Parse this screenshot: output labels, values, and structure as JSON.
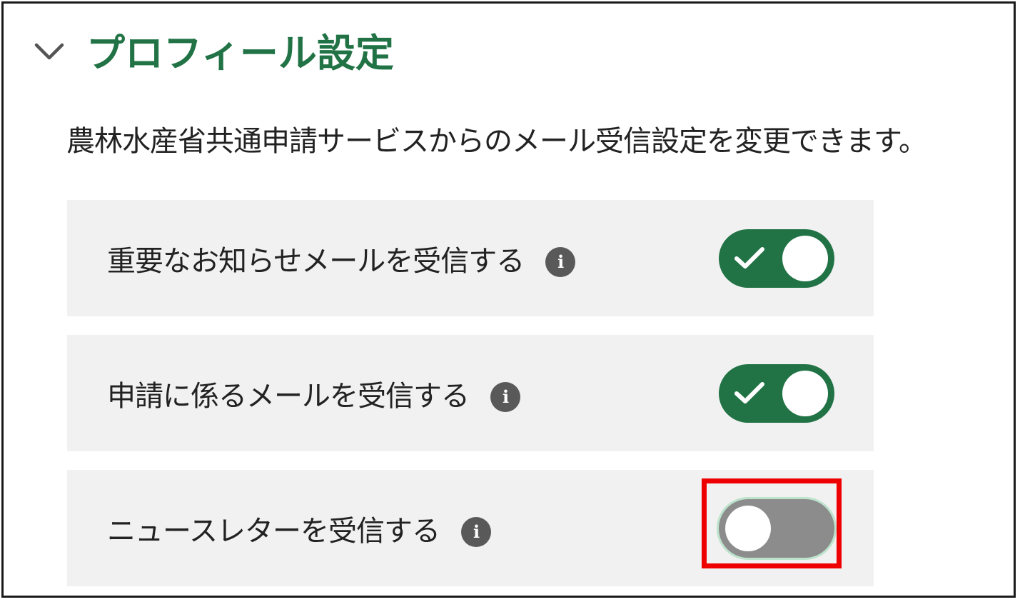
{
  "section": {
    "title": "プロフィール設定",
    "chevron_icon": "chevron-down-icon",
    "description": "農林水産省共通申請サービスからのメール受信設定を変更できます。"
  },
  "settings": [
    {
      "label": "重要なお知らせメールを受信する",
      "info_icon": "info-icon",
      "info_glyph": "i",
      "enabled": true
    },
    {
      "label": "申請に係るメールを受信する",
      "info_icon": "info-icon",
      "info_glyph": "i",
      "enabled": true
    },
    {
      "label": "ニュースレターを受信する",
      "info_icon": "info-icon",
      "info_glyph": "i",
      "enabled": false
    }
  ],
  "colors": {
    "accent": "#217346",
    "toggle_off": "#8c8c8c",
    "row_background": "#f1f1f1",
    "highlight": "#ee0000",
    "info_badge": "#595959"
  }
}
